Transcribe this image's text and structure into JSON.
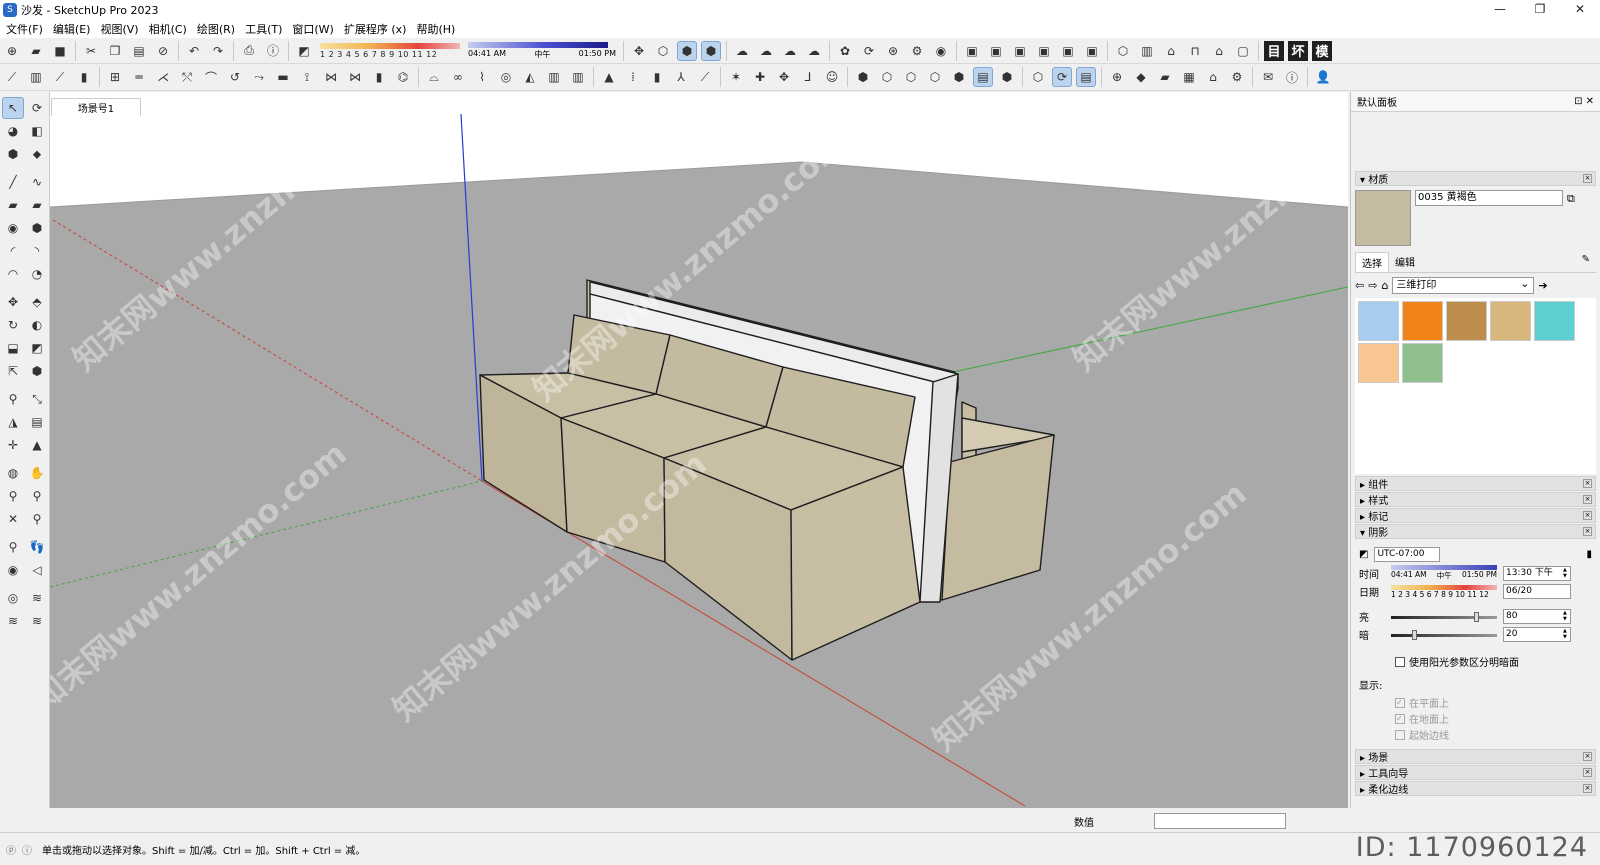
{
  "window": {
    "title": "沙发 - SketchUp Pro 2023",
    "controls": [
      "—",
      "❐",
      "✕"
    ]
  },
  "menu": [
    "文件(F)",
    "编辑(E)",
    "视图(V)",
    "相机(C)",
    "绘图(R)",
    "工具(T)",
    "窗口(W)",
    "扩展程序 (x)",
    "帮助(H)"
  ],
  "toolbar": {
    "month_numbers": "1 2 3 4 5 6 7 8 9 10 11 12",
    "time_start": "04:41 AM",
    "time_mid": "中午",
    "time_end": "01:50 PM",
    "view_buttons": [
      "目",
      "坏",
      "模"
    ]
  },
  "viewport": {
    "scene_tab": "场景号1",
    "watermark": "知末网www.znzmo.com",
    "colors": {
      "ground": "#a9a9a9",
      "sky": "#ffffff",
      "sofa": "#c5bba0",
      "axis_red": "#c8412f",
      "axis_green": "#3ea83e",
      "axis_blue": "#2a3bd4"
    }
  },
  "panel": {
    "title": "默认面板",
    "material": {
      "section": "材质",
      "name": "0035 黄褐色",
      "tab_select": "选择",
      "tab_edit": "编辑",
      "library": "三维打印",
      "swatches": [
        "#a6cdef",
        "#f08419",
        "#bd8d4c",
        "#d9b77c",
        "#5ecfd0",
        "#f8c791",
        "#8fbf8a"
      ]
    },
    "collapsed_sections": [
      "组件",
      "样式",
      "标记"
    ],
    "shadow": {
      "section": "阴影",
      "timezone": "UTC-07:00",
      "time_label": "时间",
      "time_start": "04:41 AM",
      "time_mid": "中午",
      "time_end": "01:50 PM",
      "time_value": "13:30 下午",
      "date_label": "日期",
      "date_months": "1 2 3 4 5 6 7 8 9 10 11 12",
      "date_value": "06/20",
      "light_label": "亮",
      "light_value": "80",
      "dark_label": "暗",
      "dark_value": "20",
      "use_sun_label": "使用阳光参数区分明暗面",
      "display_label": "显示:",
      "display_opts": [
        "在平面上",
        "在地面上",
        "起始边线"
      ]
    },
    "bottom_sections": [
      "场景",
      "工具向导",
      "柔化边线"
    ]
  },
  "status": {
    "hint": "单击或拖动以选择对象。Shift = 加/减。Ctrl = 加。Shift + Ctrl = 减。",
    "value_label": "数值"
  },
  "brand": "ID: 1170960124"
}
